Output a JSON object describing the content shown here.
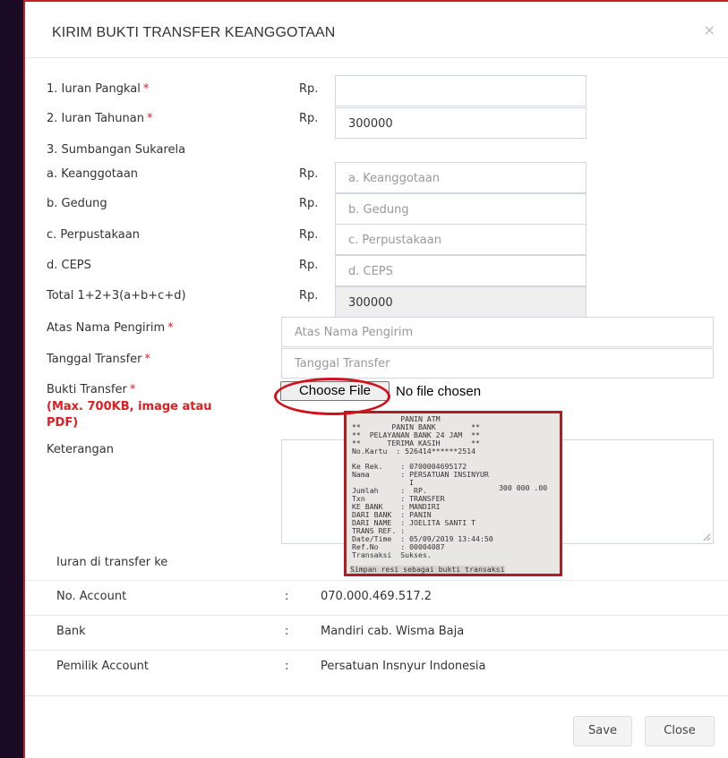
{
  "modal": {
    "title": "KIRIM BUKTI TRANSFER KEANGGOTAAN",
    "close_glyph": "×"
  },
  "form": {
    "currency": "Rp.",
    "required_mark": "*",
    "iuran_pangkal": {
      "label": "1. Iuran Pangkal",
      "value": ""
    },
    "iuran_tahunan": {
      "label": "2. Iuran Tahunan",
      "value": "300000"
    },
    "sumbangan_label": "3. Sumbangan Sukarela",
    "keanggotaan": {
      "label": "a. Keanggotaan",
      "placeholder": "a. Keanggotaan"
    },
    "gedung": {
      "label": "b. Gedung",
      "placeholder": "b. Gedung"
    },
    "perpustakaan": {
      "label": "c. Perpustakaan",
      "placeholder": "c. Perpustakaan"
    },
    "ceps": {
      "label": "d. CEPS",
      "placeholder": "d. CEPS"
    },
    "total": {
      "label": "Total 1+2+3(a+b+c+d)",
      "value": "300000"
    },
    "atas_nama": {
      "label": "Atas Nama Pengirim",
      "placeholder": "Atas Nama Pengirim"
    },
    "tanggal": {
      "label": "Tanggal Transfer",
      "placeholder": "Tanggal Transfer"
    },
    "bukti": {
      "label": "Bukti Transfer",
      "hint": "(Max. 700KB, image atau PDF)",
      "button": "Choose File",
      "status": "No file chosen"
    },
    "keterangan": {
      "label": "Keterangan"
    }
  },
  "receipt": {
    "lines_head": [
      "           PANIN ATM",
      "**       PANIN BANK        **",
      "**  PELAYANAN BANK 24 JAM  **",
      "**      TERIMA KASIH       **",
      "No.Kartu  : 526414******2514"
    ],
    "lines_body": [
      "Ke Rek.    : 0700004695172",
      "Nama       : PERSATUAN INSINYUR",
      "             I",
      "Jumlah     :  RP.",
      "Txn        : TRANSFER",
      "KE BANK    : MANDIRI",
      "DARI BANK  : PANIN",
      "DARI NAME  : JOELITA SANTI T",
      "TRANS REF. :",
      "Date/Time  : 05/09/2019 13:44:50",
      "Ref.No     : 00004087",
      "Transaksi  Sukses."
    ],
    "amount": "300 000 .00",
    "footer": "Simpan resi sebagai bukti transaksi"
  },
  "info": {
    "heading": "Iuran di transfer ke",
    "colon": ":",
    "account": {
      "label": "No. Account",
      "value": "070.000.469.517.2"
    },
    "bank": {
      "label": "Bank",
      "value": "Mandiri cab. Wisma Baja"
    },
    "owner": {
      "label": "Pemilik Account",
      "value": "Persatuan Insnyur Indonesia"
    }
  },
  "footer": {
    "save_label": "Save",
    "close_label": "Close"
  },
  "colors": {
    "required": "#e31b23",
    "annotation_red": "#d1121c",
    "backdrop": "#1a0a24"
  }
}
